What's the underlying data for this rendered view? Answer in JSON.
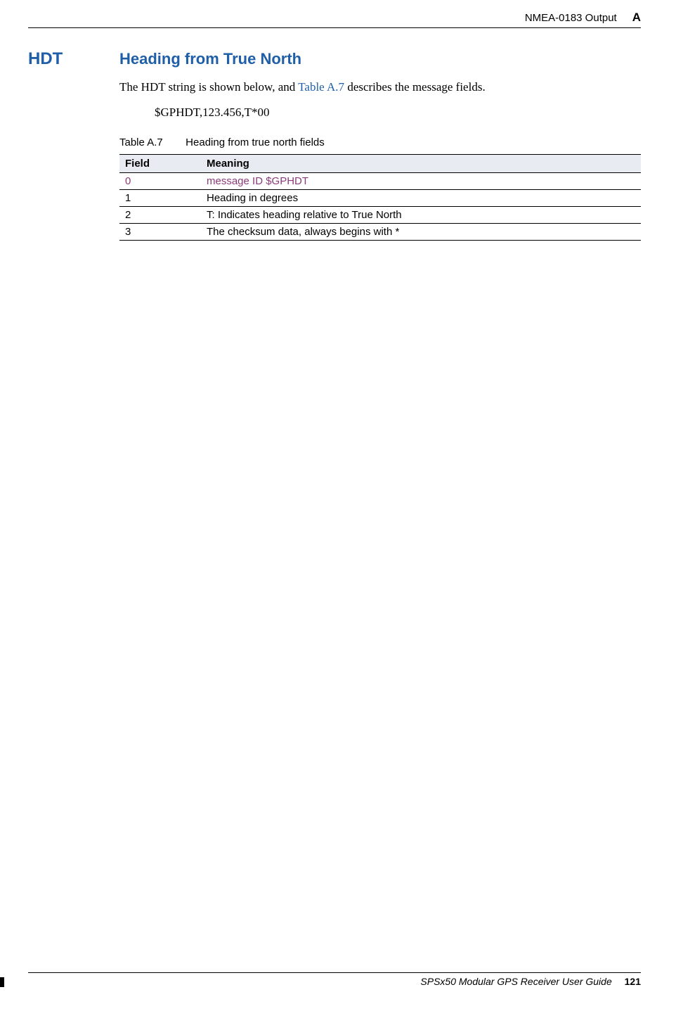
{
  "header": {
    "title": "NMEA-0183 Output",
    "appendix_letter": "A"
  },
  "section": {
    "code": "HDT",
    "title": "Heading from True North"
  },
  "paragraph": {
    "before_link": "The HDT string is shown below, and ",
    "link_text": "Table A.7",
    "after_link": " describes the message fields."
  },
  "example": "$GPHDT,123.456,T*00",
  "table": {
    "label": "Table A.7",
    "caption": "Heading from true north fields",
    "headers": {
      "col1": "Field",
      "col2": "Meaning"
    },
    "rows": [
      {
        "field": "0",
        "meaning": "message ID $GPHDT",
        "link": true
      },
      {
        "field": "1",
        "meaning": "Heading in degrees",
        "link": false
      },
      {
        "field": "2",
        "meaning": "T: Indicates heading relative to True North",
        "link": false
      },
      {
        "field": "3",
        "meaning": "The checksum data, always begins with *",
        "link": false
      }
    ]
  },
  "footer": {
    "guide": "SPSx50 Modular GPS Receiver User Guide",
    "page": "121"
  }
}
